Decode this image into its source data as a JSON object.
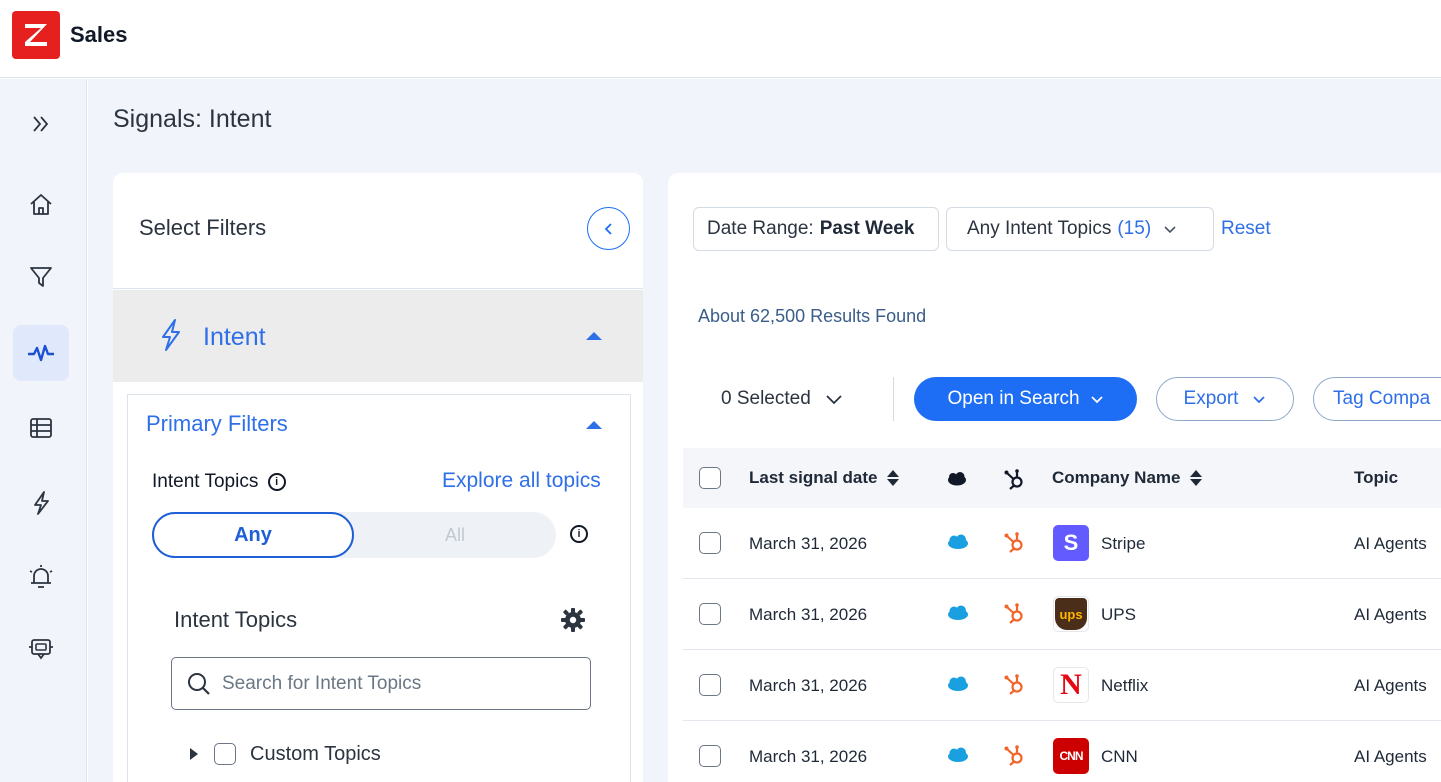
{
  "app": {
    "title": "Sales",
    "logo_letter": "Z",
    "brand_color": "#e5201f"
  },
  "rail": {
    "items": [
      {
        "name": "expand",
        "icon": "double-chevron-right-icon"
      },
      {
        "name": "home",
        "icon": "home-icon"
      },
      {
        "name": "filter",
        "icon": "filter-icon"
      },
      {
        "name": "signals",
        "icon": "pulse-icon",
        "active": true
      },
      {
        "name": "table",
        "icon": "table-icon"
      },
      {
        "name": "intent",
        "icon": "bolt-icon"
      },
      {
        "name": "alerts",
        "icon": "alarm-bell-icon"
      },
      {
        "name": "chat",
        "icon": "chat-bot-icon"
      }
    ]
  },
  "page": {
    "title": "Signals: Intent"
  },
  "filters": {
    "title": "Select Filters",
    "section": "Intent",
    "primary_title": "Primary Filters",
    "intent_topics_label": "Intent Topics",
    "explore_link": "Explore all topics",
    "toggle": {
      "any": "Any",
      "all": "All",
      "selected": "Any"
    },
    "intent_topics_title": "Intent Topics",
    "search_placeholder": "Search for Intent Topics",
    "tree": [
      {
        "label": "Custom Topics"
      }
    ]
  },
  "results": {
    "date_range_label": "Date Range:",
    "date_range_value": "Past Week",
    "topics_label": "Any Intent Topics",
    "topics_count": "(15)",
    "reset": "Reset",
    "count_text": "About 62,500 Results Found",
    "selected_text": "0 Selected",
    "open_in_search": "Open in Search",
    "export": "Export",
    "tag_companies": "Tag Compa",
    "columns": {
      "last_signal": "Last signal date",
      "company": "Company Name",
      "topic": "Topic"
    },
    "rows": [
      {
        "date": "March 31, 2026",
        "company": "Stripe",
        "topic": "AI Agents",
        "logo_text": "S",
        "logo_color": "#635bff"
      },
      {
        "date": "March 31, 2026",
        "company": "UPS",
        "topic": "AI Agents",
        "logo_text": "ups",
        "logo_color": "#4b2e1a"
      },
      {
        "date": "March 31, 2026",
        "company": "Netflix",
        "topic": "AI Agents",
        "logo_text": "N",
        "logo_color": "#e50914"
      },
      {
        "date": "March 31, 2026",
        "company": "CNN",
        "topic": "AI Agents",
        "logo_text": "CNN",
        "logo_color": "#cc0000"
      }
    ]
  }
}
